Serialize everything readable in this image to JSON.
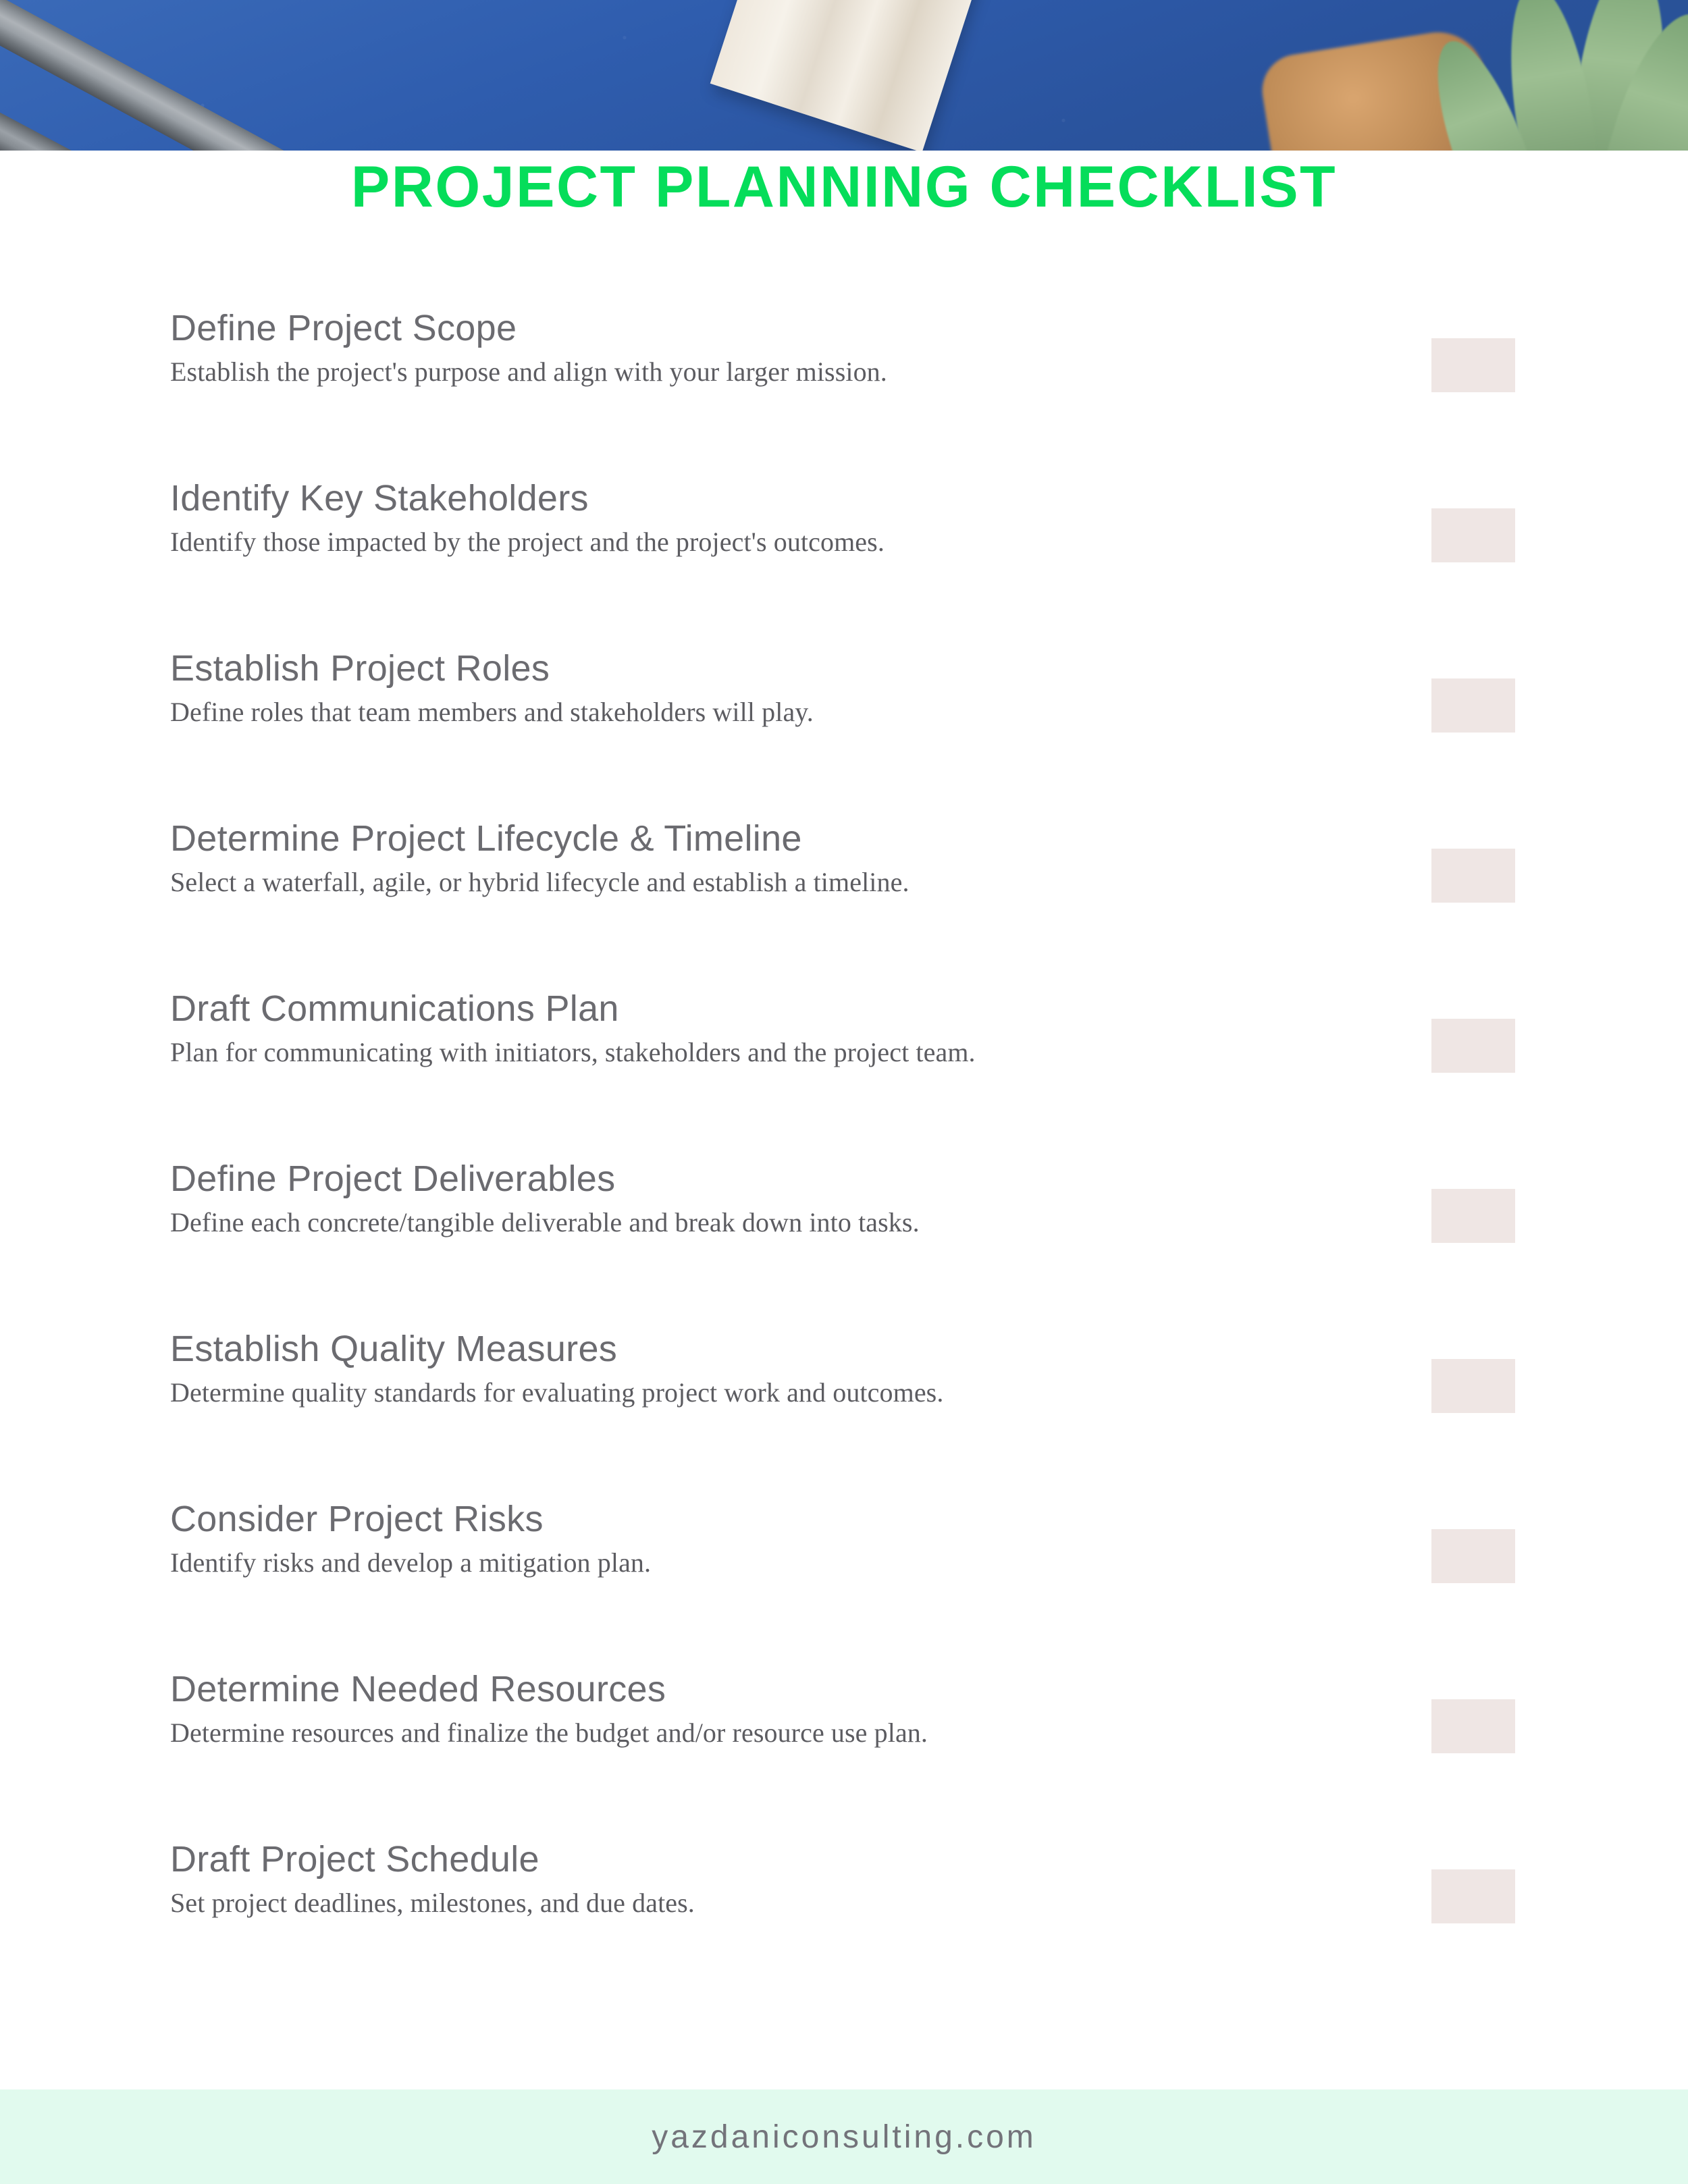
{
  "header": {
    "image_alt": "desk-flatlay-photo",
    "scene": {
      "background_color": "#2f5dae",
      "objects": [
        "gray-pencil",
        "gray-pencil",
        "spiral-notebook",
        "succulent-plant",
        "terracotta-pot"
      ]
    }
  },
  "title": "PROJECT PLANNING CHECKLIST",
  "colors": {
    "title_green": "#05DD5A",
    "checkbox_fill": "#EFE6E4",
    "footer_band": "#E1FAEE",
    "heading_gray": "#6b6b70",
    "description_gray": "#5c5c61",
    "footer_text_gray": "#73737a",
    "hero_blue": "#2f5dae"
  },
  "checklist": [
    {
      "title": "Define Project Scope",
      "description": "Establish the project's purpose and align with your larger mission.",
      "checked": false
    },
    {
      "title": "Identify Key Stakeholders",
      "description": "Identify those impacted by the project and the project's outcomes.",
      "checked": false
    },
    {
      "title": "Establish Project Roles",
      "description": "Define roles that team members and stakeholders will play.",
      "checked": false
    },
    {
      "title": "Determine Project Lifecycle & Timeline",
      "description": "Select a waterfall, agile, or hybrid lifecycle and establish a timeline.",
      "checked": false
    },
    {
      "title": "Draft Communications Plan",
      "description": "Plan for communicating with initiators, stakeholders and the project team.",
      "checked": false
    },
    {
      "title": "Define Project Deliverables",
      "description": "Define each concrete/tangible deliverable and break down into tasks.",
      "checked": false
    },
    {
      "title": "Establish Quality Measures",
      "description": "Determine quality standards for evaluating project work and outcomes.",
      "checked": false
    },
    {
      "title": "Consider Project Risks",
      "description": "Identify risks and develop a mitigation plan.",
      "checked": false
    },
    {
      "title": "Determine Needed Resources",
      "description": "Determine resources and finalize the budget and/or resource use plan.",
      "checked": false
    },
    {
      "title": "Draft Project Schedule",
      "description": "Set project deadlines, milestones, and due dates.",
      "checked": false
    }
  ],
  "footer": {
    "website": "yazdaniconsulting.com"
  }
}
